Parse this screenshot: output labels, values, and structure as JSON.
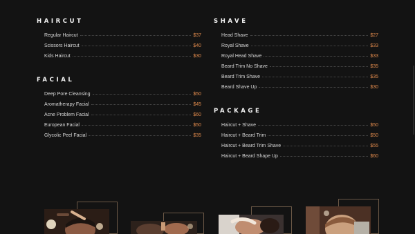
{
  "menu": {
    "sections": [
      {
        "key": "haircut",
        "title": "HAIRCUT",
        "items": [
          {
            "name": "Regular Haircut",
            "price": "$37"
          },
          {
            "name": "Scissors Haircut",
            "price": "$40"
          },
          {
            "name": "Kids Haircut",
            "price": "$30"
          }
        ]
      },
      {
        "key": "shave",
        "title": "SHAVE",
        "items": [
          {
            "name": "Head Shave",
            "price": "$27"
          },
          {
            "name": "Royal Shave",
            "price": "$33"
          },
          {
            "name": "Royal Head Shave",
            "price": "$33"
          },
          {
            "name": "Beard Trim No Shave",
            "price": "$35"
          },
          {
            "name": "Beard Trim Shave",
            "price": "$35"
          },
          {
            "name": "Beard Shave Up",
            "price": "$30"
          }
        ]
      },
      {
        "key": "facial",
        "title": "FACIAL",
        "items": [
          {
            "name": "Deep Pore Cleansing",
            "price": "$50"
          },
          {
            "name": "Aromatherapy Facial",
            "price": "$45"
          },
          {
            "name": "Acne Problem Facial",
            "price": "$60"
          },
          {
            "name": "European Facial",
            "price": "$50"
          },
          {
            "name": "Glycolic Peel Facial",
            "price": "$35"
          }
        ]
      },
      {
        "key": "package",
        "title": "PACKAGE",
        "items": [
          {
            "name": "Haircut + Shave",
            "price": "$50"
          },
          {
            "name": "Haircut + Beard Trim",
            "price": "$50"
          },
          {
            "name": "Haircut + Beard Trim Shave",
            "price": "$55"
          },
          {
            "name": "Haircut + Beard Shape Up",
            "price": "$60"
          }
        ]
      }
    ]
  },
  "gallery": {
    "photos": [
      {
        "subject": "barber-styling-hair"
      },
      {
        "subject": "barber-at-work"
      },
      {
        "subject": "client-getting-shave"
      },
      {
        "subject": "client-haircut-back-view"
      }
    ]
  },
  "colors": {
    "background": "#131313",
    "accent": "#e08a4c",
    "heading": "#f2f2f2",
    "text": "#d8d8d8",
    "frame": "#6b5846"
  }
}
